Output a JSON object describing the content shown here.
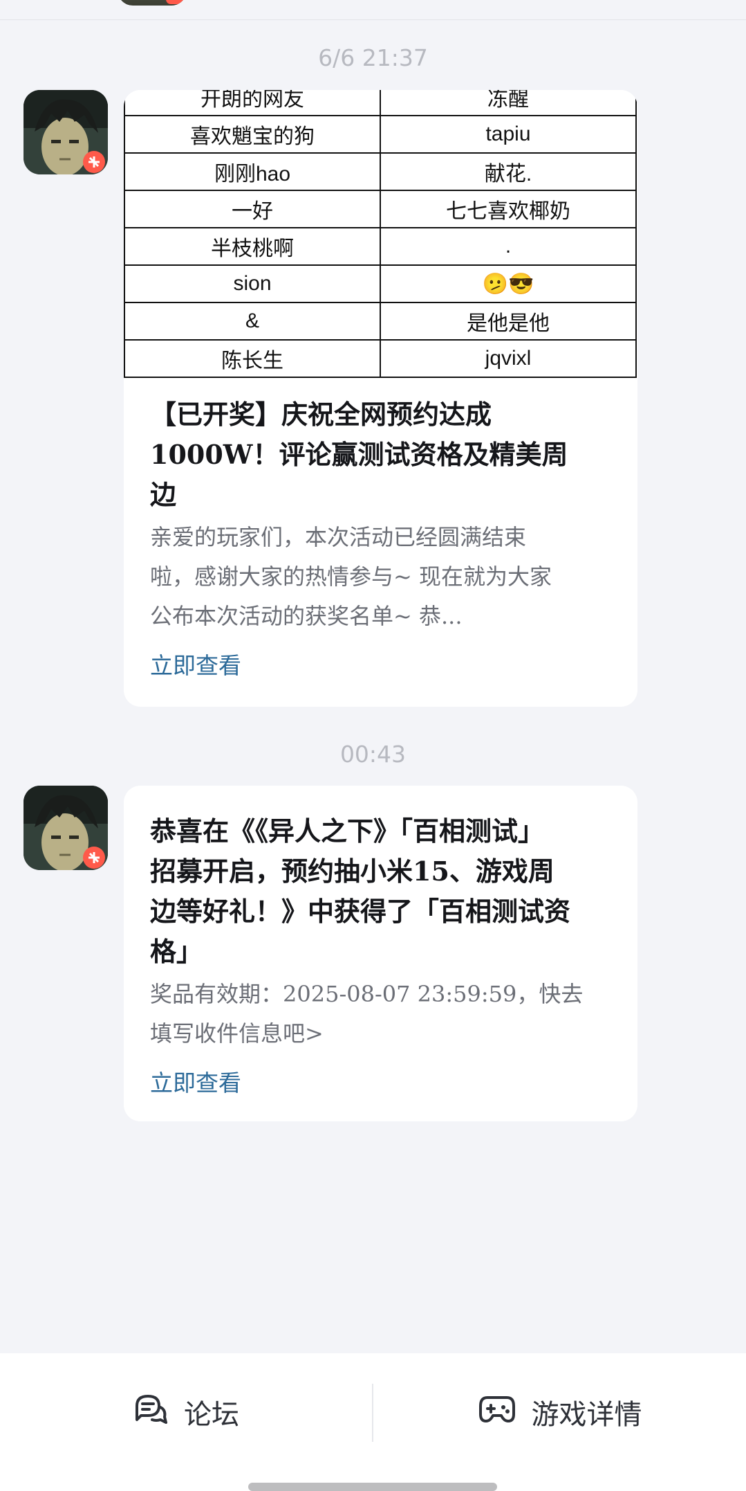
{
  "messages": [
    {
      "timestamp": "6/6  21:37",
      "winners_table": [
        [
          "开朗的网友",
          "冻醒"
        ],
        [
          "喜欢魈宝的狗",
          "tapiu"
        ],
        [
          "刚刚hao",
          "献花."
        ],
        [
          "一好",
          "七七喜欢椰奶"
        ],
        [
          "半枝桃啊",
          "."
        ],
        [
          "sion",
          "🫤😎"
        ],
        [
          "&",
          "是他是他"
        ],
        [
          "陈长生",
          "jqvixl"
        ]
      ],
      "title_lines": [
        "【已开奖】庆祝全网预约达成",
        "1000W！评论赢测试资格及精美周",
        "边"
      ],
      "desc_lines": [
        "亲爱的玩家们，本次活动已经圆满结束",
        "啦，感谢大家的热情参与~ 现在就为大家",
        "公布本次活动的获奖名单~ 恭..."
      ],
      "link": "立即查看"
    },
    {
      "timestamp": "00:43",
      "title_lines": [
        "恭喜在《《异人之下》「百相测试」",
        "招募开启，预约抽小米15、游戏周",
        "边等好礼！》中获得了「百相测试资",
        "格」"
      ],
      "desc_lines": [
        "奖品有效期：2025-08-07 23:59:59，快去",
        "填写收件信息吧>"
      ],
      "link": "立即查看"
    }
  ],
  "bottom_nav": {
    "forum_label": "论坛",
    "forum_icon": "chat-bubble-icon",
    "game_label": "游戏详情",
    "game_icon": "gamepad-icon"
  }
}
